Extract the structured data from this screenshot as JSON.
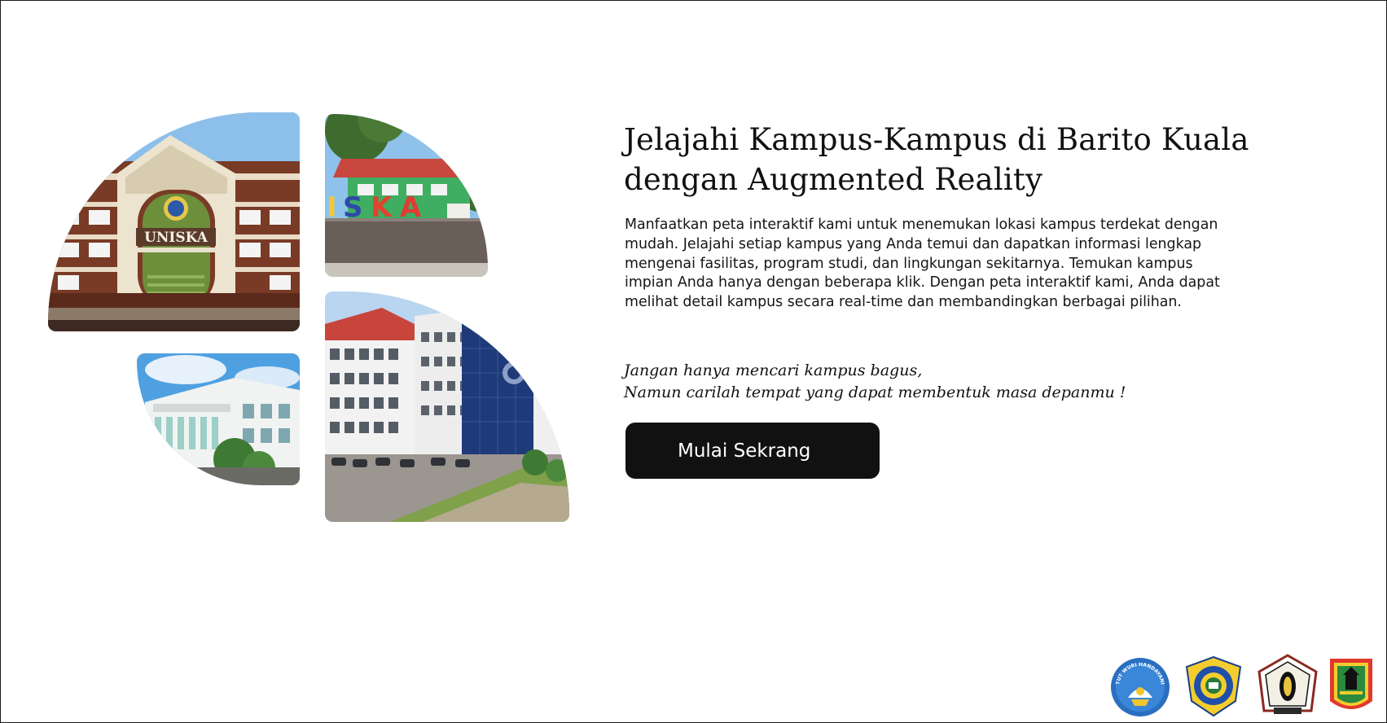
{
  "hero": {
    "title_line1": "Jelajahi Kampus-Kampus di Barito Kuala",
    "title_line2": "dengan Augmented Reality",
    "description": "Manfaatkan peta interaktif kami untuk menemukan lokasi kampus terdekat dengan mudah. Jelajahi setiap kampus yang Anda temui dan dapatkan informasi lengkap mengenai fasilitas, program studi, dan lingkungan sekitarnya. Temukan kampus impian Anda hanya dengan beberapa klik. Dengan peta interaktif kami, Anda dapat melihat detail kampus secara real-time dan membandingkan berbagai pilihan.",
    "quote_line1": "Jangan hanya mencari kampus bagus,",
    "quote_line2": "Namun carilah tempat yang dapat membentuk masa depanmu !",
    "cta_label": "Mulai Sekrang"
  },
  "photos": {
    "photo_1_sign": "UNISKA",
    "photo_2_sign": "ISKA"
  },
  "logos": [
    {
      "icon": "tut-wuri-handayani-icon",
      "text": "TUT WURI HANDAYANI"
    },
    {
      "icon": "university-crest-icon"
    },
    {
      "icon": "regional-shield-icon"
    },
    {
      "icon": "provincial-emblem-icon"
    }
  ],
  "colors": {
    "button_bg": "#111111",
    "button_text": "#ffffff",
    "text": "#111111",
    "border": "#1a1a1a"
  }
}
